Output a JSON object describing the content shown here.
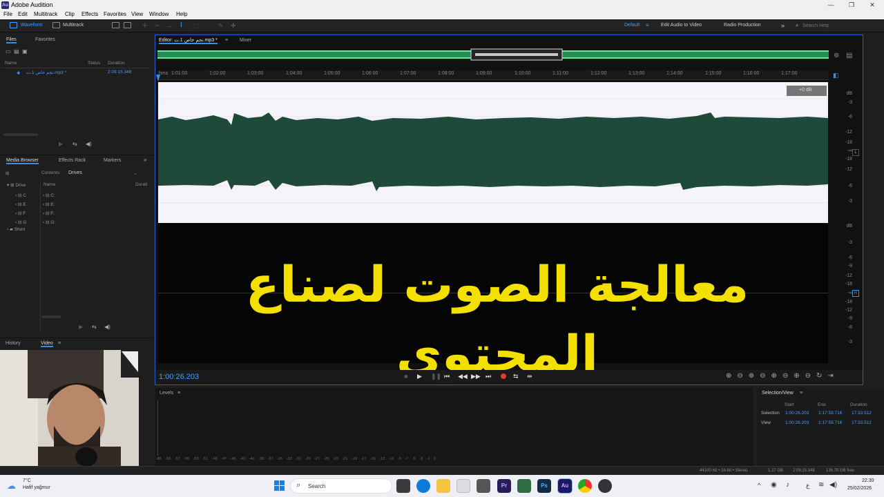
{
  "app": {
    "title": "Adobe Audition",
    "icon_text": "Au"
  },
  "window_controls": {
    "minimize": "—",
    "restore": "❐",
    "close": "✕"
  },
  "menu": [
    "File",
    "Edit",
    "Multitrack",
    "Clip",
    "Effects",
    "Favorites",
    "View",
    "Window",
    "Help"
  ],
  "toolbar": {
    "waveform": "Waveform",
    "multitrack": "Multitrack",
    "workspaces": [
      "Default",
      "Edit Audio to Video",
      "Radio Production"
    ],
    "more": "»",
    "search_placeholder": "Search Help"
  },
  "files_panel": {
    "tabs": [
      "Files",
      "Favorites"
    ],
    "columns": [
      "Name",
      "Status",
      "Duration"
    ],
    "file": {
      "name": "نجم خاص 1.ت.mp3 *",
      "duration": "2:09:15.348"
    }
  },
  "media_browser": {
    "tabs": [
      "Media Browser",
      "Effects Rack",
      "Markers"
    ],
    "contents_label": "Contents:",
    "contents_value": "Drives",
    "left_tree": [
      "Drive",
      "Short"
    ],
    "name_col": "Name",
    "dur_col": "Durati",
    "drives": [
      "C:",
      "E:",
      "F:",
      "G:"
    ]
  },
  "history_panel": {
    "tabs": [
      "History",
      "Video"
    ]
  },
  "editor": {
    "tab": "Editor: نجم خاص 1.ت.mp3 *",
    "mixer_tab": "Mixer",
    "hud": "+0 dB",
    "ruler_start": "hms",
    "ruler": [
      "1:01:00",
      "1:02:00",
      "1:03:00",
      "1:04:00",
      "1:05:00",
      "1:06:00",
      "1:07:00",
      "1:08:00",
      "1:09:00",
      "1:10:00",
      "1:11:00",
      "1:12:00",
      "1:13:00",
      "1:14:00",
      "1:15:00",
      "1:16:00",
      "1:17:00"
    ],
    "db_scale_top": [
      "dB",
      "-3",
      "-6",
      "-12",
      "-18",
      "-∞",
      "-18",
      "-12",
      "-6",
      "-3"
    ],
    "db_scale_bottom": [
      "dB",
      "-3",
      "-6",
      "-9",
      "-12",
      "-18",
      "-∞",
      "-18",
      "-12",
      "-9",
      "-6",
      "-3"
    ],
    "channel_labels": [
      "L",
      "R"
    ],
    "overlay_text": "معالجة الصوت لصناع المحتوى"
  },
  "transport": {
    "time": "1:00:26.203"
  },
  "levels": {
    "title": "Levels",
    "scale": [
      "dB",
      "-59",
      "-57",
      "-55",
      "-53",
      "-51",
      "-49",
      "-47",
      "-45",
      "-43",
      "-41",
      "-39",
      "-37",
      "-35",
      "-33",
      "-31",
      "-29",
      "-27",
      "-25",
      "-23",
      "-21",
      "-19",
      "-17",
      "-15",
      "-13",
      "-11",
      "-9",
      "-7",
      "-5",
      "-3",
      "-1",
      "0"
    ]
  },
  "selection_view": {
    "title": "Selection/View",
    "cols": [
      "Start",
      "End",
      "Duration"
    ],
    "selection": {
      "label": "Selection",
      "start": "1:00:26.203",
      "end": "1:17:59.716",
      "duration": "17:33.512"
    },
    "view": {
      "label": "View",
      "start": "1:00:26.203",
      "end": "1:17:59.716",
      "duration": "17:33.512"
    }
  },
  "status": {
    "format": "44100 Hz • 16-bit • Stereo",
    "size": "1.27 GB",
    "duration": "2:09:15.348",
    "free": "136.70 GB free"
  },
  "taskbar": {
    "weather_temp": "7°C",
    "weather_desc": "Hafif yağmur",
    "search": "Search",
    "time": "22:30",
    "date": "25/02/2026",
    "lang": "ع"
  },
  "colors": {
    "accent": "#3a8ee6",
    "waveform": "#1f4a3a",
    "overview": "#3ee08a",
    "overlay": "#f3e000"
  }
}
